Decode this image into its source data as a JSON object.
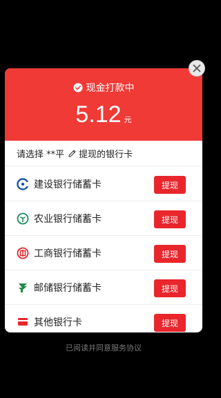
{
  "dialog": {
    "status_text": "现金打款中",
    "amount": "5.12",
    "currency": "元",
    "select_prefix": "请选择 **平",
    "select_suffix": "提现的银行卡",
    "accent_color": "#f03a36"
  },
  "banks": [
    {
      "name": "建设银行储蓄卡",
      "icon": "ccb-logo-icon",
      "button": "提现"
    },
    {
      "name": "农业银行储蓄卡",
      "icon": "abc-logo-icon",
      "button": "提现"
    },
    {
      "name": "工商银行储蓄卡",
      "icon": "icbc-logo-icon",
      "button": "提现"
    },
    {
      "name": "邮储银行储蓄卡",
      "icon": "psbc-logo-icon",
      "button": "提现"
    },
    {
      "name": "其他银行卡",
      "icon": "other-bank-icon",
      "button": "提现"
    }
  ],
  "footer": {
    "agreement_text": "已阅读并同意服务协议"
  }
}
